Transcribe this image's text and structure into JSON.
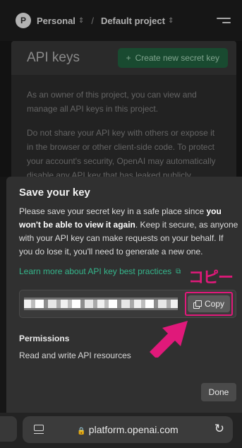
{
  "header": {
    "avatar_letter": "P",
    "org": "Personal",
    "separator": "/",
    "project": "Default project",
    "selector_icon": "chevron-updown-icon",
    "menu_icon": "hamburger-icon"
  },
  "background": {
    "title": "API keys",
    "create_button": "Create new secret key",
    "create_icon": "plus-icon",
    "paragraph1": "As an owner of this project, you can view and manage all API keys in this project.",
    "paragraph2": "Do not share your API key with others or expose it in the browser or other client-side code. To protect your account's security, OpenAI may automatically disable any API key that has leaked publicly."
  },
  "sheet": {
    "title": "Save your key",
    "body_pre": "Please save your secret key in a safe place since ",
    "body_bold": "you won't be able to view it again",
    "body_post": ". Keep it secure, as anyone with your API key can make requests on your behalf. If you do lose it, you'll need to generate a new one.",
    "learn_link": "Learn more about API key best practices",
    "copy_button": "Copy",
    "copy_icon": "copy-icon",
    "annotation": "コピー",
    "permissions_title": "Permissions",
    "permissions_value": "Read and write API resources",
    "done_button": "Done"
  },
  "browser": {
    "url": "platform.openai.com",
    "lock_icon": "lock-icon",
    "tabs_icon": "tabs-icon",
    "reload_icon": "reload-icon"
  },
  "colors": {
    "accent_green": "#35b58b",
    "annotation_pink": "#e0197a",
    "create_button_bg": "#1f5b3b"
  }
}
